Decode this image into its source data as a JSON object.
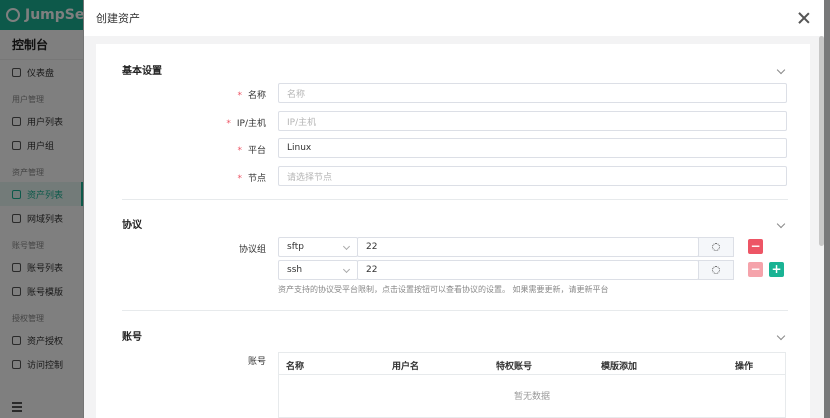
{
  "sidebar": {
    "brand": "JumpServer",
    "console": "控制台",
    "items": [
      {
        "type": "item",
        "label": "仪表盘"
      },
      {
        "type": "group",
        "label": "用户管理"
      },
      {
        "type": "item",
        "label": "用户列表"
      },
      {
        "type": "item",
        "label": "用户组"
      },
      {
        "type": "group",
        "label": "资产管理"
      },
      {
        "type": "item",
        "label": "资产列表",
        "active": true
      },
      {
        "type": "item",
        "label": "网域列表"
      },
      {
        "type": "group",
        "label": "账号管理"
      },
      {
        "type": "item",
        "label": "账号列表"
      },
      {
        "type": "item",
        "label": "账号模版"
      },
      {
        "type": "group",
        "label": "授权管理"
      },
      {
        "type": "item",
        "label": "资产授权"
      },
      {
        "type": "item",
        "label": "访问控制"
      }
    ]
  },
  "drawer": {
    "title": "创建资产",
    "basic": {
      "title": "基本设置",
      "name_label": "名称",
      "name_placeholder": "名称",
      "ip_label": "IP/主机",
      "ip_placeholder": "IP/主机",
      "platform_label": "平台",
      "platform_value": "Linux",
      "node_label": "节点",
      "node_placeholder": "请选择节点"
    },
    "protocol": {
      "title": "协议",
      "group_label": "协议组",
      "rows": [
        {
          "name": "sftp",
          "port": "22"
        },
        {
          "name": "ssh",
          "port": "22"
        }
      ],
      "hint": "资产支持的协议受平台限制，点击设置按钮可以查看协议的设置。 如果需要更新，请更新平台"
    },
    "account": {
      "title": "账号",
      "label": "账号",
      "columns": [
        "名称",
        "用户名",
        "特权账号",
        "模版添加",
        "操作"
      ],
      "empty": "暂无数据"
    }
  },
  "colors": {
    "accent": "#1ab394",
    "danger": "#ed5565",
    "required": "#ed5565"
  }
}
